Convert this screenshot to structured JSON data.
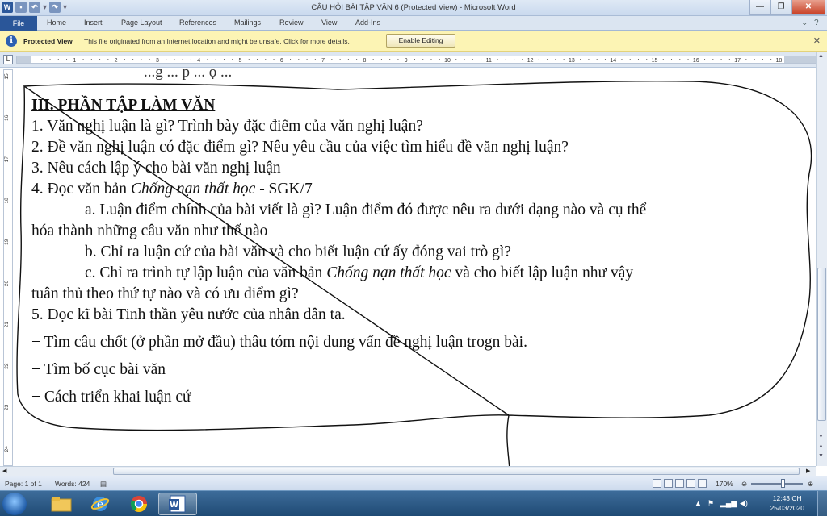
{
  "window": {
    "title": "CÂU HỎI BÀI TẬP VĂN 6 (Protected View)  -  Microsoft Word",
    "logo_letter": "W"
  },
  "ribbon": {
    "tabs": [
      "File",
      "Home",
      "Insert",
      "Page Layout",
      "References",
      "Mailings",
      "Review",
      "View",
      "Add-Ins"
    ]
  },
  "protected_bar": {
    "title": "Protected View",
    "message": "This file originated from an Internet location and might be unsafe. Click for more details.",
    "button": "Enable Editing"
  },
  "ruler": {
    "numbers": [
      "1",
      "2",
      "3",
      "4",
      "5",
      "6",
      "7",
      "8",
      "9",
      "10",
      "11",
      "12",
      "13",
      "14",
      "15",
      "16",
      "17",
      "18"
    ]
  },
  "vruler": {
    "numbers": [
      "15",
      "16",
      "17",
      "18",
      "19",
      "20",
      "21",
      "22",
      "23",
      "24"
    ]
  },
  "document": {
    "heading": "III. PHẦN TẬP LÀM VĂN",
    "q1": "1. Văn nghị luận là gì? Trình bày đặc điểm của văn nghị luận?",
    "q2": "2. Đề văn nghị luận có đặc điểm gì? Nêu yêu cầu của việc tìm hiểu đề văn nghị luận?",
    "q3": "3. Nêu cách lập ý cho bài văn nghị luận",
    "q4_prefix": "4. Đọc  văn bản ",
    "q4_title": "Chống nạn thất học",
    "q4_suffix": " - SGK/7",
    "q4a_line1": "a. Luận điểm chính của bài viết là gì? Luận điểm đó được nêu ra dưới dạng nào và cụ thể",
    "q4a_line2": "hóa thành những câu văn như thế nào",
    "q4b": "b. Chỉ ra luận cứ của bài văn và cho biết luận cứ ấy đóng vai trò gì?",
    "q4c_prefix": "c. Chỉ ra trình tự lập luận của văn bản  ",
    "q4c_title": "Chống nạn thất học",
    "q4c_suffix": "  và cho biết lập luận như vậy",
    "q4c_line2": "tuân thủ theo thứ tự nào và có ưu điểm gì?",
    "q5": "5. Đọc kĩ bài Tinh thần yêu nước của nhân dân ta.",
    "b1": "+ Tìm câu chốt (ở phần mở đầu) thâu tóm nội dung vấn đề nghị luận trogn bài.",
    "b2": "+ Tìm bố cục bài văn",
    "b3": "+ Cách  triển khai luận cứ",
    "cut_text": "...g ... p ... ọ ..."
  },
  "status": {
    "page": "Page: 1 of 1",
    "words": "Words: 424",
    "zoom": "170%"
  },
  "taskbar": {
    "time": "12:43 CH",
    "date": "25/03/2020"
  }
}
